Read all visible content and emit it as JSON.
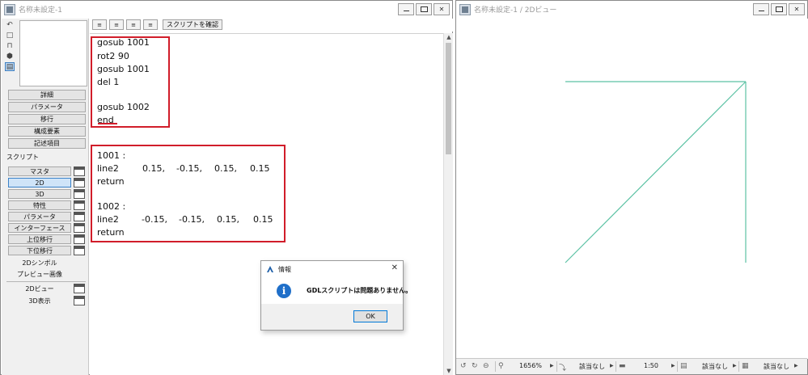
{
  "left_window": {
    "title": "名称未設定-1",
    "sidebar": {
      "section_buttons": [
        "詳細",
        "パラメータ",
        "移行",
        "構成要素",
        "記述項目"
      ],
      "script_label": "スクリプト",
      "scripts": [
        {
          "label": "マスタ",
          "has_window": true
        },
        {
          "label": "2D",
          "has_window": true,
          "active": true
        },
        {
          "label": "3D",
          "has_window": true
        },
        {
          "label": "特性",
          "has_window": true
        },
        {
          "label": "パラメータ",
          "has_window": true
        },
        {
          "label": "インターフェース",
          "has_window": true
        },
        {
          "label": "上位移行",
          "has_window": true
        },
        {
          "label": "下位移行",
          "has_window": true
        },
        {
          "label": "2Dシンボル",
          "has_window": false
        },
        {
          "label": "プレビュー画像",
          "has_window": false
        }
      ],
      "views": [
        {
          "label": "2Dビュー",
          "has_window": true
        },
        {
          "label": "3D表示",
          "has_window": true
        }
      ]
    },
    "toolbar": {
      "check_button_label": "スクリプトを確認"
    },
    "code_block_1": [
      "gosub 1001",
      "rot2 90",
      "gosub 1001",
      "del 1",
      "",
      "gosub 1002",
      "end"
    ],
    "code_block_2": [
      {
        "cols": [
          "1001 :"
        ]
      },
      {
        "cols": [
          "line2",
          "0.15,",
          "-0.15,",
          "0.15,",
          "0.15"
        ]
      },
      {
        "cols": [
          "return"
        ]
      },
      {
        "cols": [
          ""
        ]
      },
      {
        "cols": [
          "1002 :"
        ]
      },
      {
        "cols": [
          "line2",
          "-0.15,",
          "-0.15,",
          "0.15,",
          "0.15"
        ]
      },
      {
        "cols": [
          "return"
        ]
      }
    ],
    "highlight_color": "#d11d2a"
  },
  "dialog": {
    "title": "情報",
    "close_glyph": "✕",
    "message": "GDLスクリプトは問題ありません。",
    "ok_label": "OK",
    "icon": "info-icon"
  },
  "right_window": {
    "title": "名称未設定-1 / 2Dビュー",
    "line_color": "#5cc2a4",
    "status": {
      "zoom": "1656%",
      "layer": "該当なし",
      "scale": "1:50",
      "pen_set": "該当なし",
      "model_view": "該当なし"
    }
  }
}
